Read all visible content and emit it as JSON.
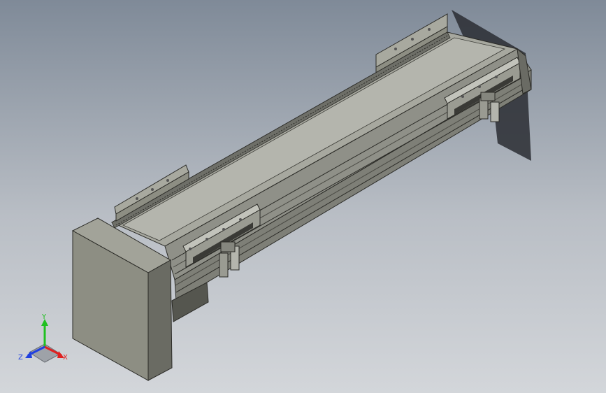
{
  "viewport": {
    "background_top": "#7f8a98",
    "background_bottom": "#d3d6da"
  },
  "model": {
    "body_color": "#a7a89f",
    "end_cap_color": "#8d8e83",
    "rail_color": "#b4b5ad",
    "edge_color": "#2a2a26",
    "shadow_color": "#2a2d33"
  },
  "triad": {
    "x_label": "X",
    "y_label": "Y",
    "z_label": "Z",
    "x_color": "#e02020",
    "y_color": "#20c020",
    "z_color": "#2040e0"
  }
}
